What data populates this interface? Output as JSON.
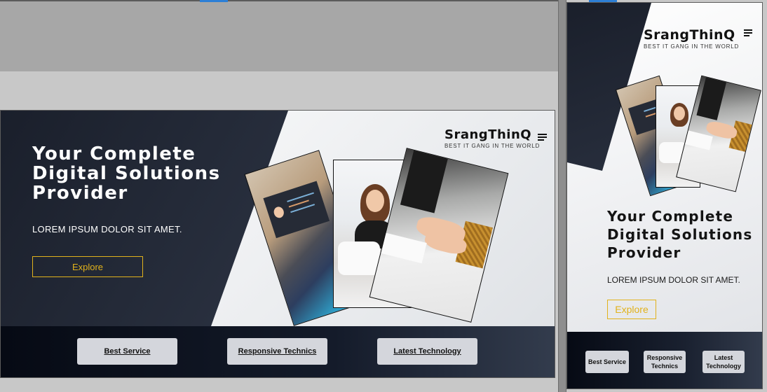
{
  "site": {
    "brand_name": "SrangThinQ",
    "brand_tagline": "BEST IT GANG IN THE WORLD",
    "hero_title": "Your Complete Digital Solutions Provider",
    "hero_subtitle": "LOREM IPSUM DOLOR SIT AMET.",
    "explore_label": "Explore",
    "features": [
      {
        "label": "Best Service"
      },
      {
        "label": "Responsive Technics"
      },
      {
        "label": "Latest Technology"
      }
    ]
  },
  "colors": {
    "accent": "#e1b21c",
    "dark": "#1a1f2b",
    "feature_button": "#d4d6dc",
    "editor_highlight": "#2d7fd6"
  },
  "icons": {
    "menu": "hamburger-menu-icon"
  }
}
